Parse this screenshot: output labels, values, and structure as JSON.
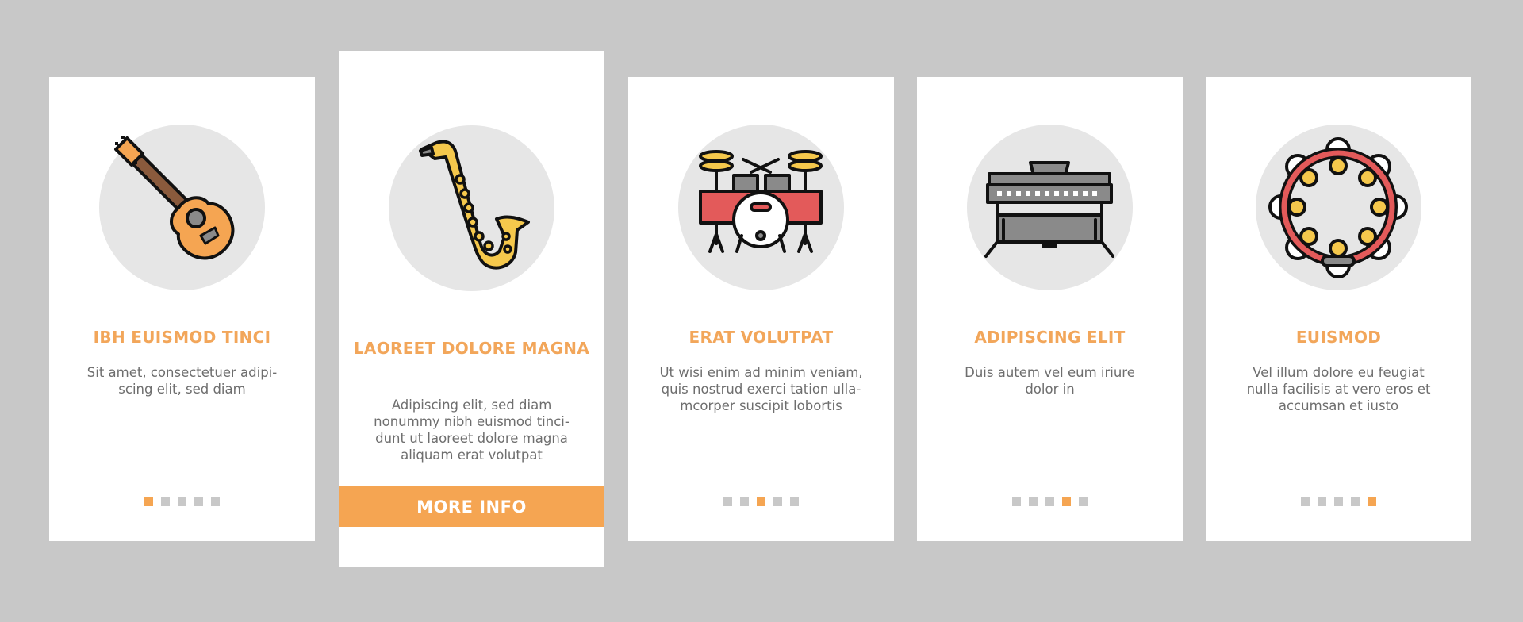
{
  "colors": {
    "background": "#c8c8c8",
    "card": "#ffffff",
    "accent": "#f5a552",
    "title": "#f2a65a",
    "text": "#6e6e6e",
    "dot_inactive": "#c8c8c8",
    "icon_circle": "#e6e6e6"
  },
  "cards": [
    {
      "icon": "acoustic-guitar-icon",
      "title": "IBH EUISMOD TINCI",
      "description": "Sit amet, consectetuer adipi-\nscing elit, sed diam",
      "active_page": 1,
      "total_pages": 5
    },
    {
      "icon": "saxophone-icon",
      "title": "LAOREET DOLORE MAGNA",
      "description": "Adipiscing elit, sed diam\nnonummy nibh euismod tinci-\ndunt ut laoreet dolore magna\naliquam erat volutpat",
      "button_label": "MORE INFO"
    },
    {
      "icon": "drum-kit-icon",
      "title": "ERAT VOLUTPAT",
      "description": "Ut wisi enim ad minim veniam,\nquis nostrud exerci tation ulla-\nmcorper suscipit lobortis",
      "active_page": 3,
      "total_pages": 5
    },
    {
      "icon": "digital-piano-icon",
      "title": "ADIPISCING ELIT",
      "description": "Duis autem vel eum iriure\ndolor in",
      "active_page": 4,
      "total_pages": 5
    },
    {
      "icon": "tambourine-icon",
      "title": "EUISMOD",
      "description": "Vel illum dolore eu feugiat\nnulla facilisis at vero eros et\naccumsan et iusto",
      "active_page": 5,
      "total_pages": 5
    }
  ]
}
